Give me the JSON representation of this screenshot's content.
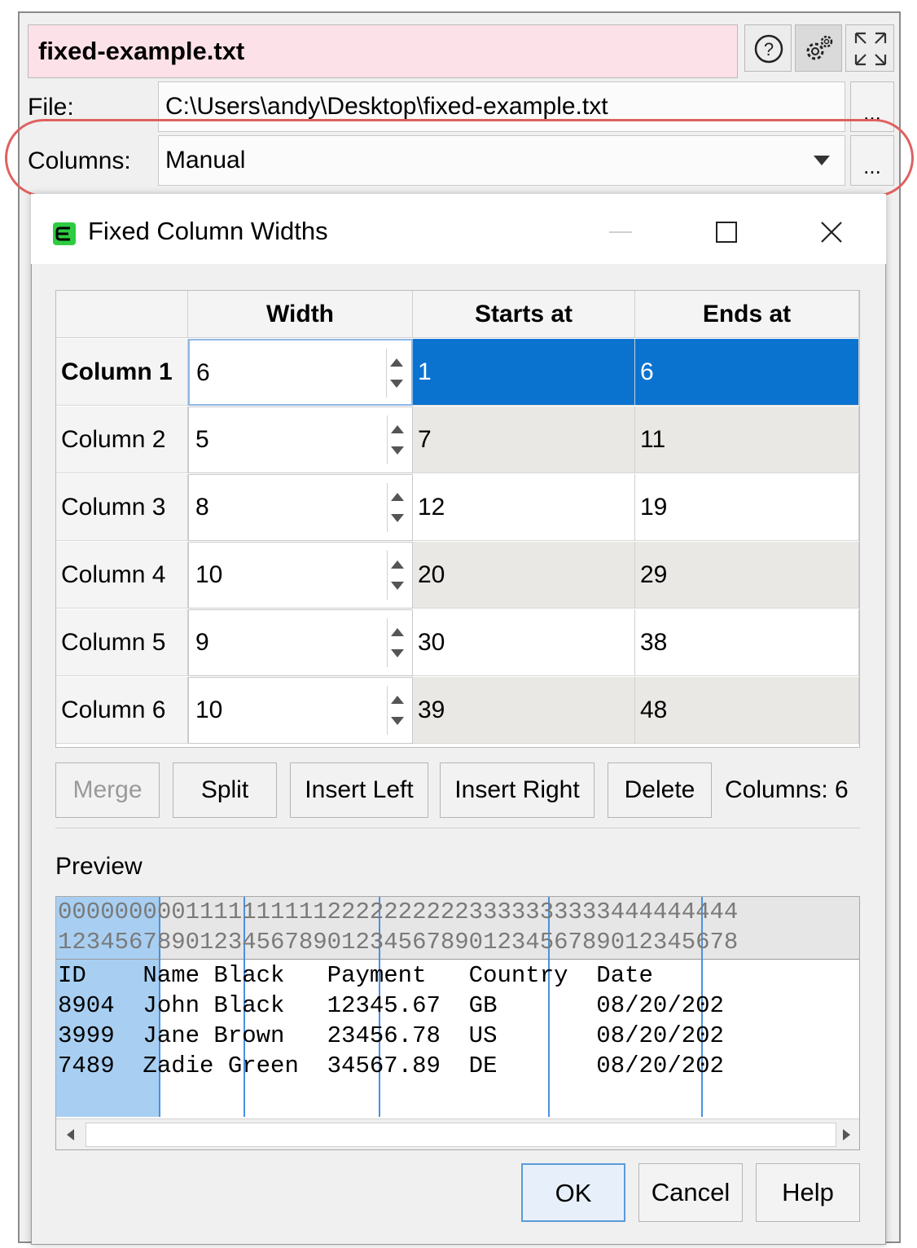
{
  "panel": {
    "title": "fixed-example.txt",
    "file_label": "File:",
    "file_path": "C:\\Users\\andy\\Desktop\\fixed-example.txt",
    "columns_label": "Columns:",
    "columns_value": "Manual",
    "ellipsis": "..."
  },
  "dialog": {
    "title": "Fixed Column Widths",
    "table": {
      "headers": [
        "Width",
        "Starts at",
        "Ends at"
      ],
      "rows": [
        {
          "name": "Column 1",
          "width": "6",
          "start": "1",
          "end": "6"
        },
        {
          "name": "Column 2",
          "width": "5",
          "start": "7",
          "end": "11"
        },
        {
          "name": "Column 3",
          "width": "8",
          "start": "12",
          "end": "19"
        },
        {
          "name": "Column 4",
          "width": "10",
          "start": "20",
          "end": "29"
        },
        {
          "name": "Column 5",
          "width": "9",
          "start": "30",
          "end": "38"
        },
        {
          "name": "Column 6",
          "width": "10",
          "start": "39",
          "end": "48"
        }
      ]
    },
    "buttons": {
      "merge": "Merge",
      "split": "Split",
      "insert_left": "Insert Left",
      "insert_right": "Insert Right",
      "delete": "Delete"
    },
    "columns_count": "Columns: 6",
    "preview_label": "Preview",
    "preview": {
      "ruler1": "000000000111111111122222222223333333333444444444",
      "ruler2": "123456789012345678901234567890123456789012345678",
      "lines": [
        "ID    Name Black   Payment   Country  Date",
        "8904  John Black   12345.67  GB       08/20/202",
        "3999  Jane Brown   23456.78  US       08/20/202",
        "7489  Zadie Green  34567.89  DE       08/20/202"
      ]
    },
    "ok": "OK",
    "cancel": "Cancel",
    "help": "Help"
  },
  "colors": {
    "title_bg": "#fde1e8",
    "selection": "#0a73d0",
    "preview_highlight": "#a8cff2",
    "highlight_ring": "#e06060",
    "app_icon": "#2ecc40"
  }
}
